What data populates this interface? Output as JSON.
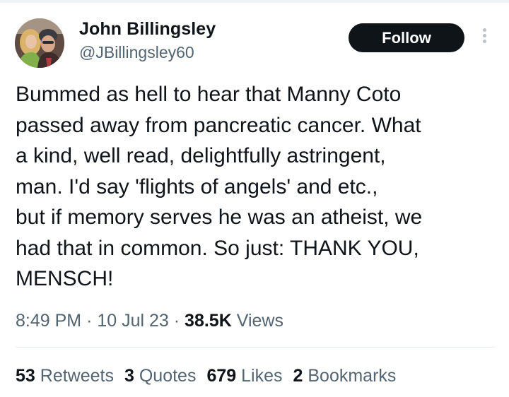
{
  "tweet": {
    "author": {
      "name": "John Billingsley",
      "handle": "@JBillingsley60",
      "avatar_icon": "profile-photo"
    },
    "follow_label": "Follow",
    "more_icon": "vertical-ellipsis-icon",
    "text_lines": [
      "Bummed as hell to hear that Manny Coto",
      "passed away from pancreatic cancer.  What",
      "a kind, well read, delightfully astringent,",
      "man.  I'd say 'flights of angels' and etc.,",
      "but if memory serves he was an atheist, we",
      "had that in common.  So just: THANK YOU,",
      "MENSCH!"
    ],
    "time": "8:49 PM",
    "date": "10 Jul 23",
    "separator": "·",
    "views_count": "38.5K",
    "views_label": "Views"
  },
  "stats": [
    {
      "count": "53",
      "label": "Retweets"
    },
    {
      "count": "3",
      "label": "Quotes"
    },
    {
      "count": "679",
      "label": "Likes"
    },
    {
      "count": "2",
      "label": "Bookmarks"
    }
  ],
  "colors": {
    "text": "#0f1419",
    "secondary_text": "#536471",
    "button_bg": "#0f1419",
    "button_text": "#ffffff",
    "divider": "#e6ecf0"
  }
}
